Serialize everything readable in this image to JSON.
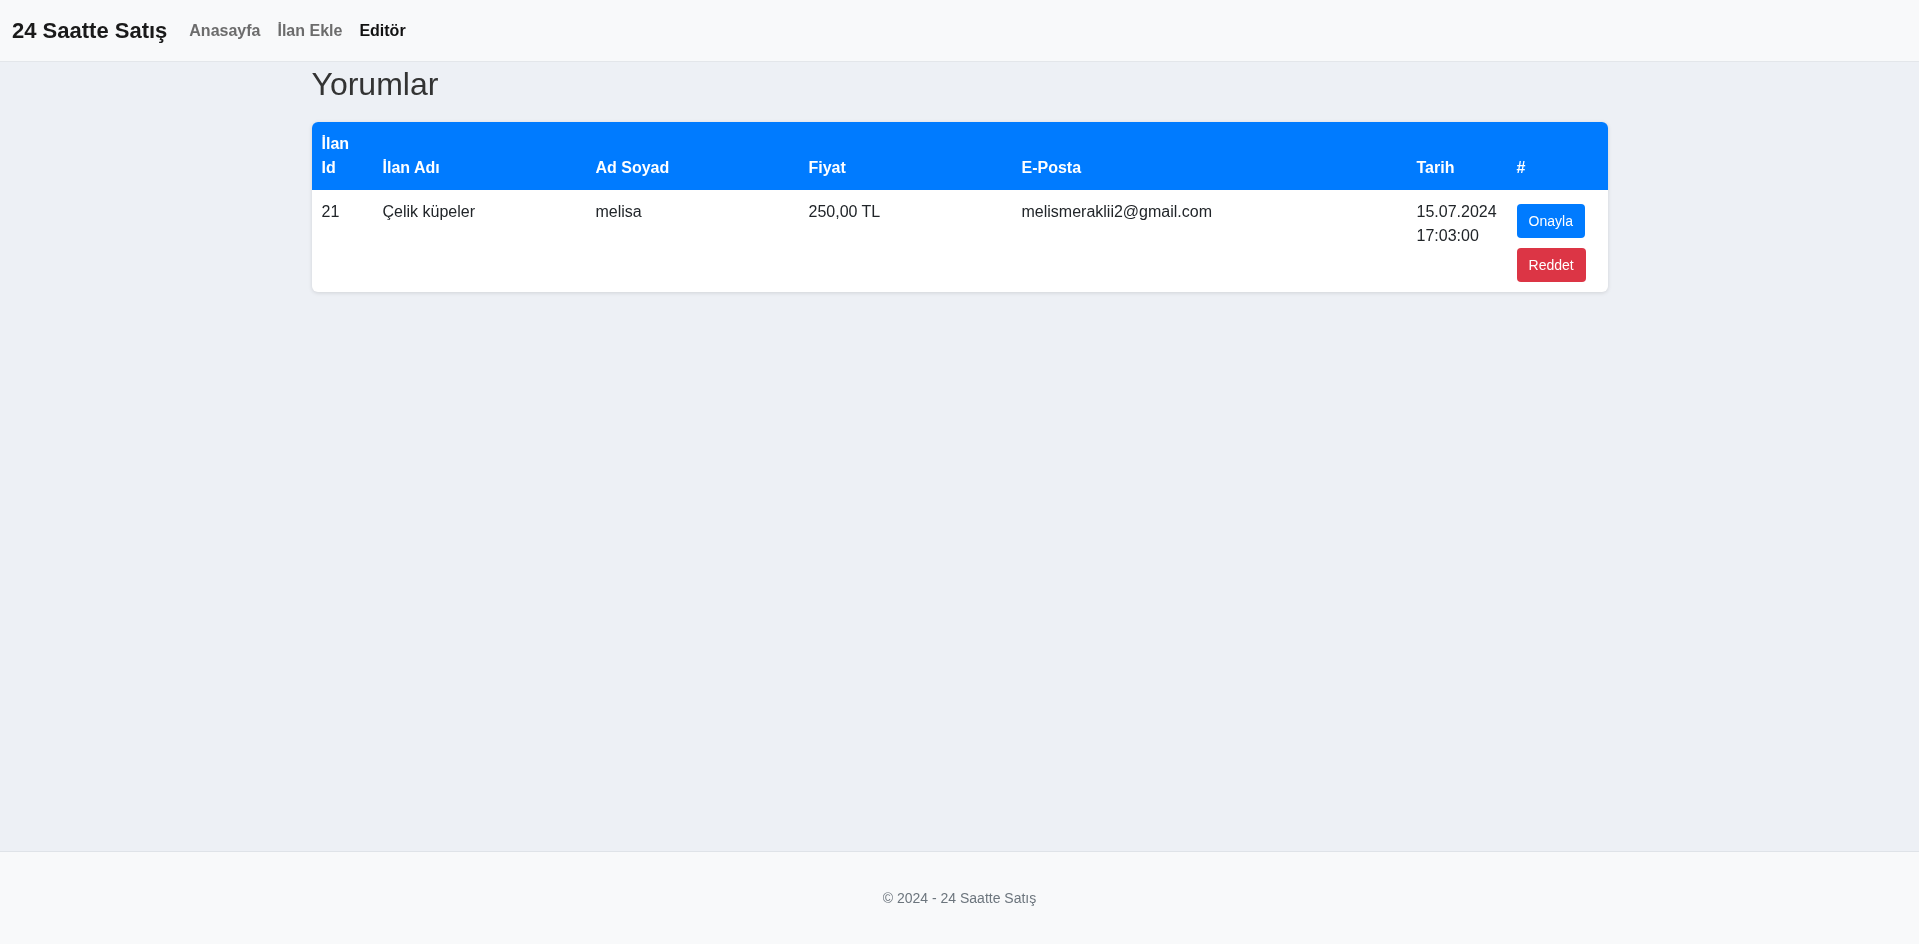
{
  "navbar": {
    "brand": "24 Saatte Satış",
    "links": [
      {
        "label": "Anasayfa",
        "selected": false
      },
      {
        "label": "İlan Ekle",
        "selected": false
      },
      {
        "label": "Editör",
        "selected": true
      }
    ]
  },
  "page_title": "Yorumlar",
  "table": {
    "columns": [
      "İlan Id",
      "İlan Adı",
      "Ad Soyad",
      "Fiyat",
      "E-Posta",
      "Tarih",
      "#"
    ],
    "rows": [
      {
        "cells": [
          "21",
          "Çelik küpeler",
          "melisa",
          "250,00 TL",
          "melismeraklii2@gmail.com",
          "15.07.2024 17:03:00"
        ],
        "actions": [
          {
            "label": "Onayla",
            "kind": "approve"
          },
          {
            "label": "Reddet",
            "kind": "reject"
          }
        ]
      }
    ]
  },
  "footer": "© 2024 - 24 Saatte Satış"
}
